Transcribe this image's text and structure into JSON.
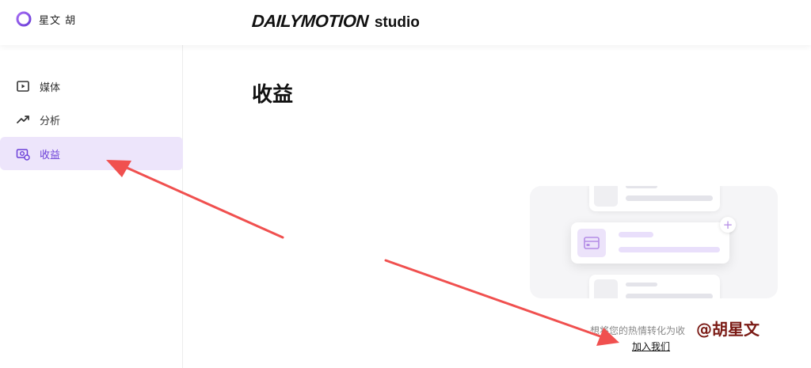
{
  "header": {
    "user_name": "星文 胡",
    "brand": "DAILYMOTION",
    "brand_suffix": "studio"
  },
  "sidebar": {
    "items": [
      {
        "label": "媒体",
        "icon": "play-square-icon",
        "active": false
      },
      {
        "label": "分析",
        "icon": "trend-up-icon",
        "active": false
      },
      {
        "label": "收益",
        "icon": "money-icon",
        "active": true
      }
    ]
  },
  "main": {
    "title": "收益",
    "cta_text": "想将您的热情转化为收",
    "join_link": "加入我们"
  },
  "watermark": "@胡星文",
  "colors": {
    "accent": "#6b3fd8",
    "active_bg": "#ede5fb",
    "arrow": "#f0504f"
  }
}
